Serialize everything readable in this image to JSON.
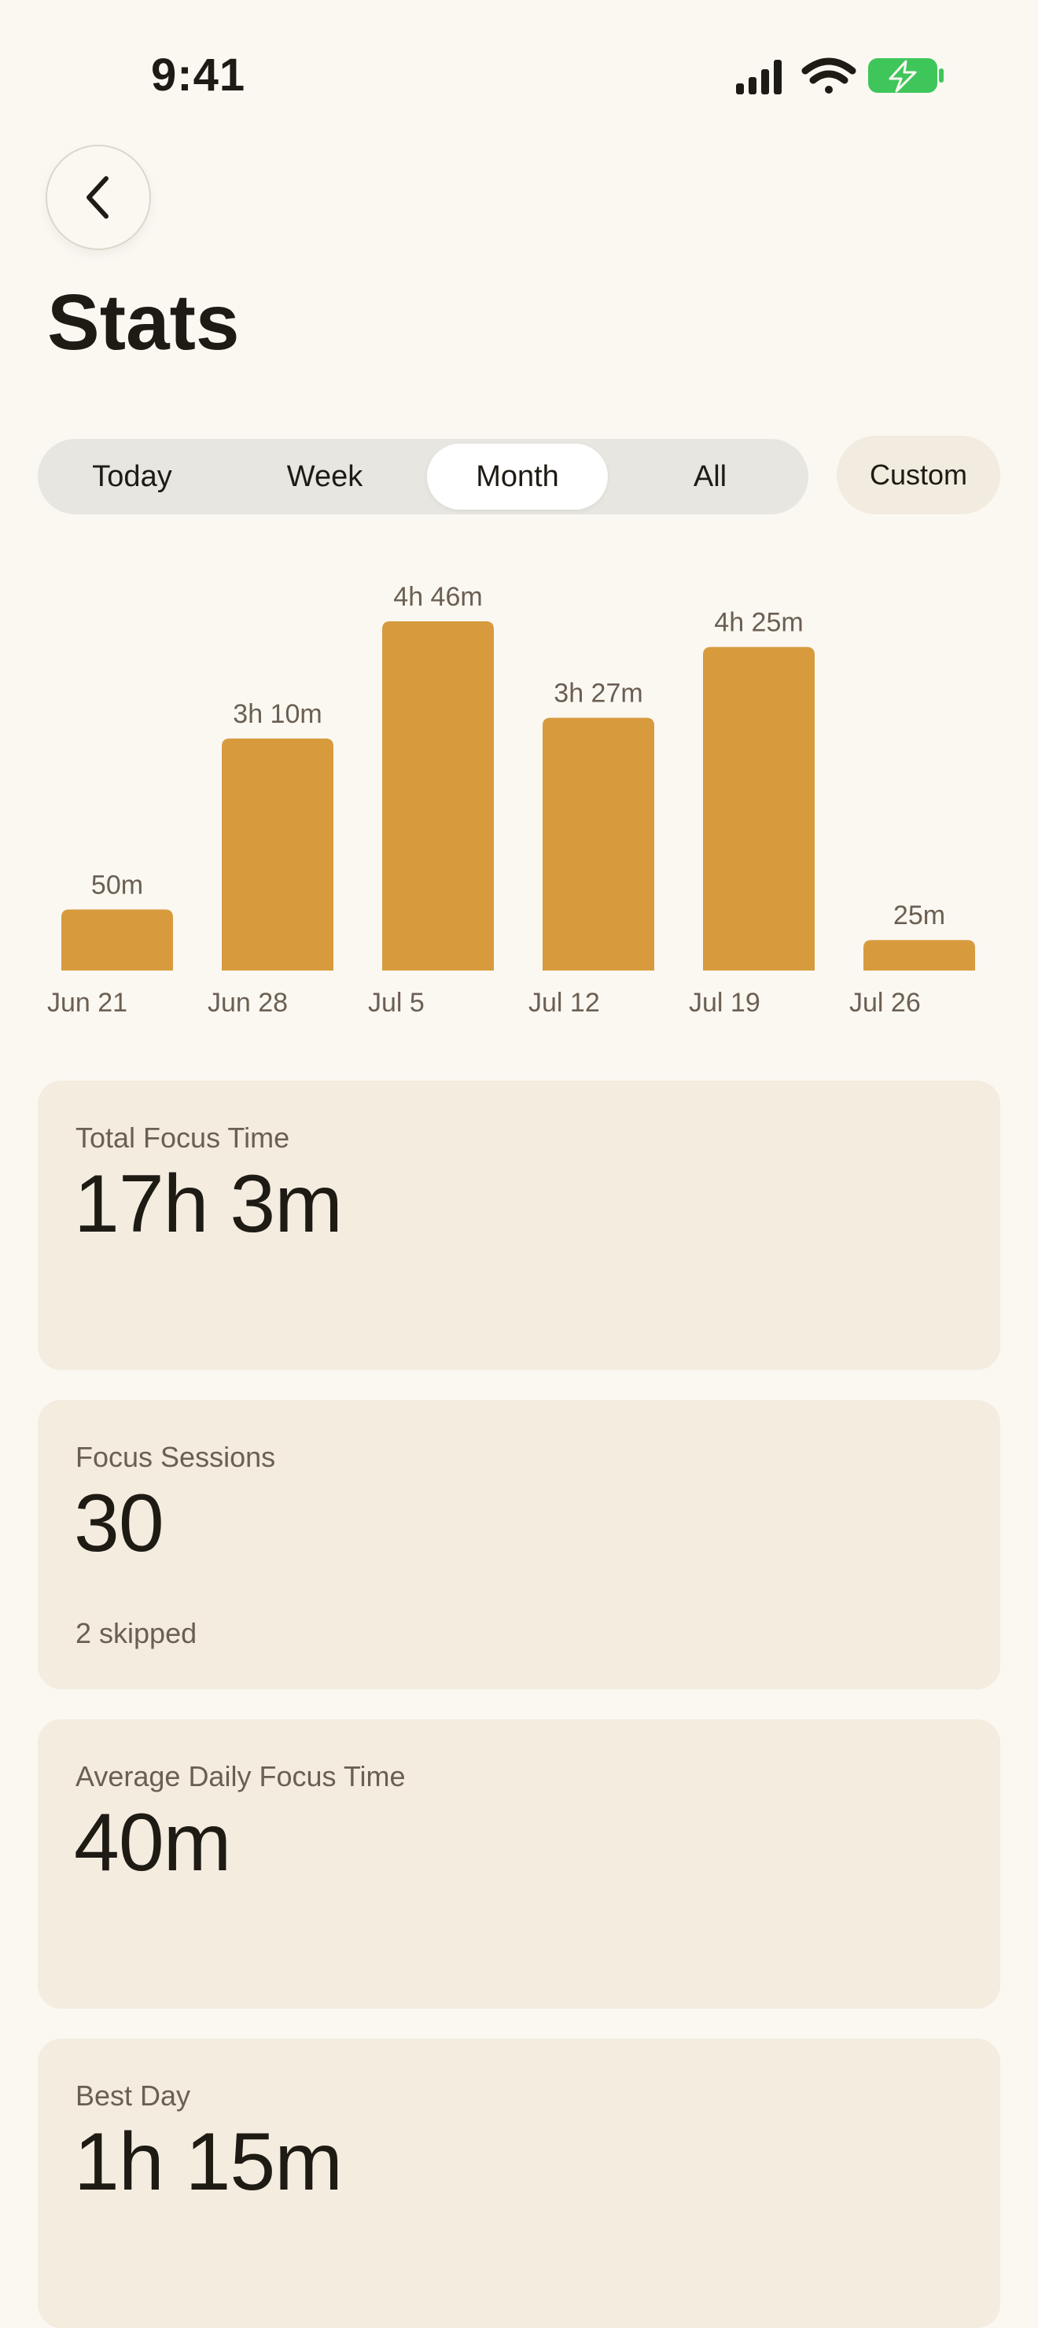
{
  "status_bar": {
    "time": "9:41",
    "icons": [
      "cellular-signal-icon",
      "wifi-icon",
      "battery-charging-icon"
    ],
    "battery_color": "#3FC65A"
  },
  "header": {
    "back_icon": "chevron-left-icon",
    "title": "Stats"
  },
  "range_picker": {
    "options": [
      {
        "label": "Today",
        "selected": false
      },
      {
        "label": "Week",
        "selected": false
      },
      {
        "label": "Month",
        "selected": true
      },
      {
        "label": "All",
        "selected": false
      }
    ],
    "custom_label": "Custom"
  },
  "colors": {
    "bar": "#D79B3E",
    "background": "#FBF8F2",
    "card": "#F3ECDF"
  },
  "chart_data": {
    "type": "bar",
    "categories": [
      "Jun 21",
      "Jun 28",
      "Jul 5",
      "Jul 12",
      "Jul 19",
      "Jul 26"
    ],
    "values": [
      50,
      190,
      286,
      207,
      265,
      25
    ],
    "value_labels": [
      "50m",
      "3h 10m",
      "4h 46m",
      "3h 27m",
      "4h 25m",
      "25m"
    ],
    "unit": "minutes",
    "ylim": [
      0,
      286
    ],
    "grid": false
  },
  "cards": [
    {
      "label": "Total Focus Time",
      "value": "17h 3m",
      "sub": ""
    },
    {
      "label": "Focus Sessions",
      "value": "30",
      "sub": "2 skipped"
    },
    {
      "label": "Average Daily Focus Time",
      "value": "40m",
      "sub": ""
    },
    {
      "label": "Best Day",
      "value": "1h 15m",
      "sub": ""
    }
  ]
}
